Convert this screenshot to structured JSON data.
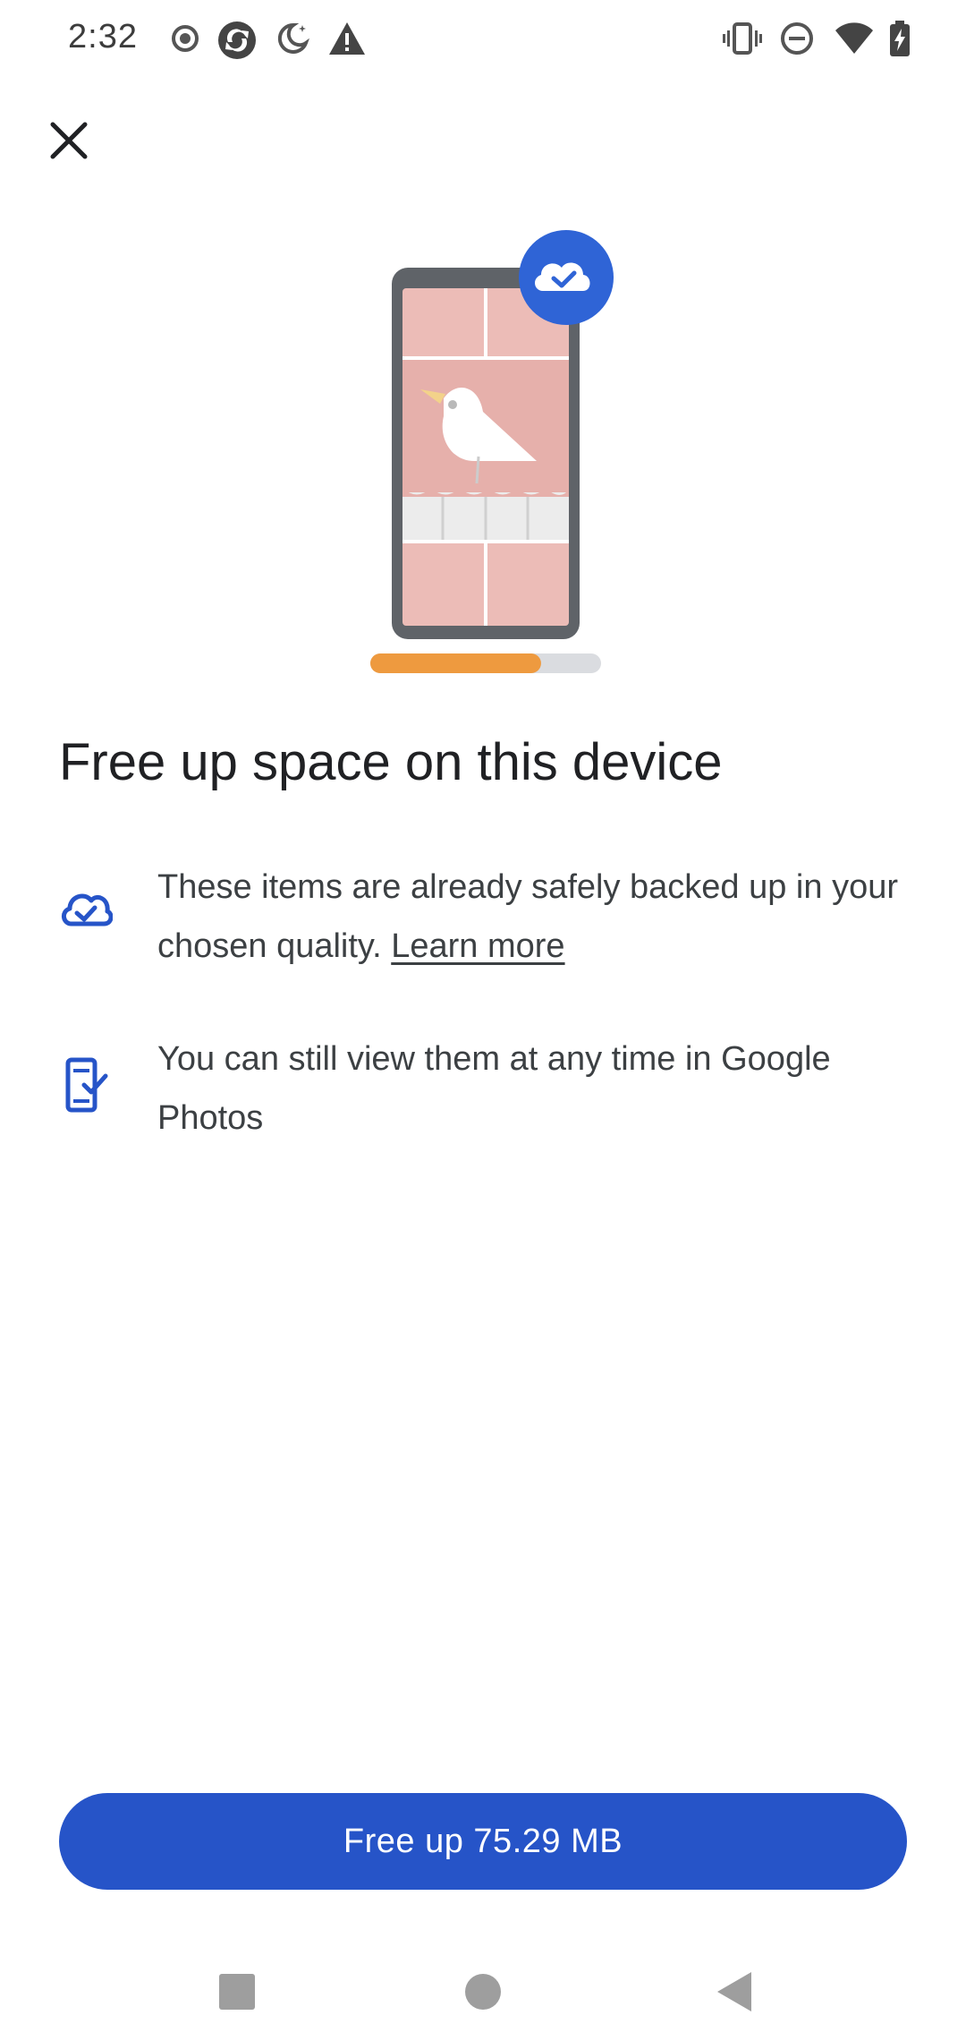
{
  "status_bar": {
    "time": "2:32",
    "left_icons": [
      "record-icon",
      "app-sync-icon",
      "bedtime-icon",
      "warning-icon"
    ],
    "right_icons": [
      "vibrate-icon",
      "do-not-disturb-icon",
      "wifi-icon",
      "battery-charging-icon"
    ]
  },
  "header": {
    "close_icon": "close-icon"
  },
  "illustration": {
    "description_icon": "phone-backup-illustration",
    "progress": 0.74,
    "colors": {
      "phone": "#5f6368",
      "screen": "#e8b4b0",
      "badge": "#2f64d6",
      "progress_fill": "#ee9a3f",
      "progress_track": "#dadce0"
    }
  },
  "main": {
    "title": "Free up space on this device",
    "rows": [
      {
        "icon": "cloud-done-icon",
        "text": "These items are already safely backed up in your chosen quality. ",
        "link": "Learn more"
      },
      {
        "icon": "phone-check-icon",
        "text": "You can still view them at any time in Google Photos"
      }
    ]
  },
  "footer": {
    "primary_button_label": "Free up 75.29 MB",
    "accent": "#2654c8"
  },
  "nav_bar": {
    "recents_icon": "square-icon",
    "home_icon": "circle-icon",
    "back_icon": "back-triangle-icon"
  }
}
